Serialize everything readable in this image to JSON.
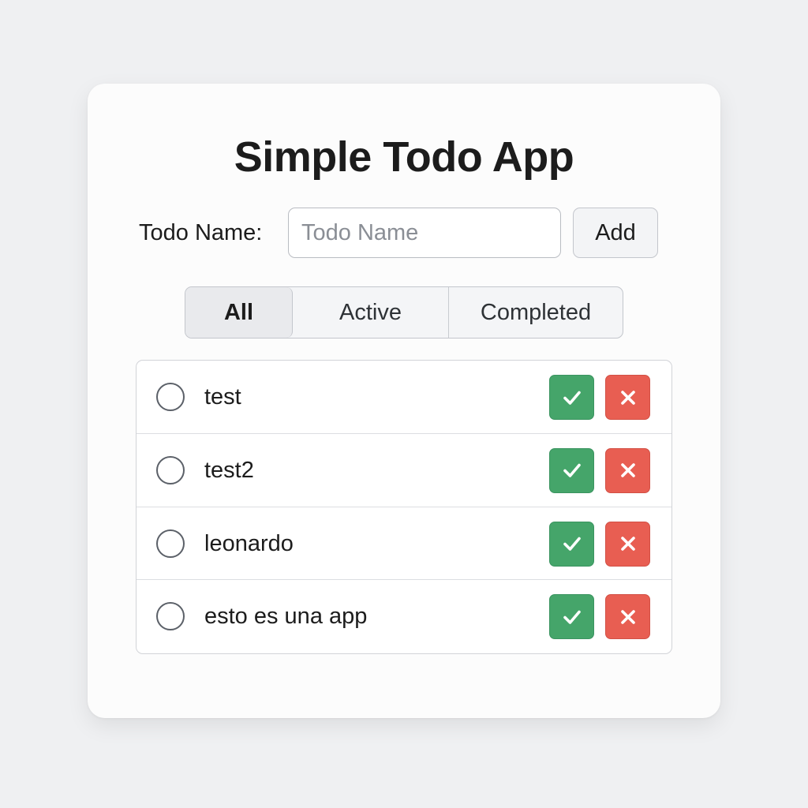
{
  "app": {
    "title": "Simple Todo App"
  },
  "form": {
    "label": "Todo Name:",
    "input_value": "",
    "input_placeholder": "Todo Name",
    "add_label": "Add"
  },
  "filters": {
    "selected": "All",
    "tabs": [
      {
        "label": "All"
      },
      {
        "label": "Active"
      },
      {
        "label": "Completed"
      }
    ]
  },
  "todos": [
    {
      "text": "test",
      "completed": false
    },
    {
      "text": "test2",
      "completed": false
    },
    {
      "text": "leonardo",
      "completed": false
    },
    {
      "text": "esto es una app",
      "completed": false
    }
  ],
  "icons": {
    "complete": "check-icon",
    "delete": "close-icon",
    "status": "circle-radio-icon"
  },
  "colors": {
    "complete_button": "#45a56a",
    "delete_button": "#e85e52",
    "background": "#eff0f2",
    "card": "#fcfcfc"
  }
}
